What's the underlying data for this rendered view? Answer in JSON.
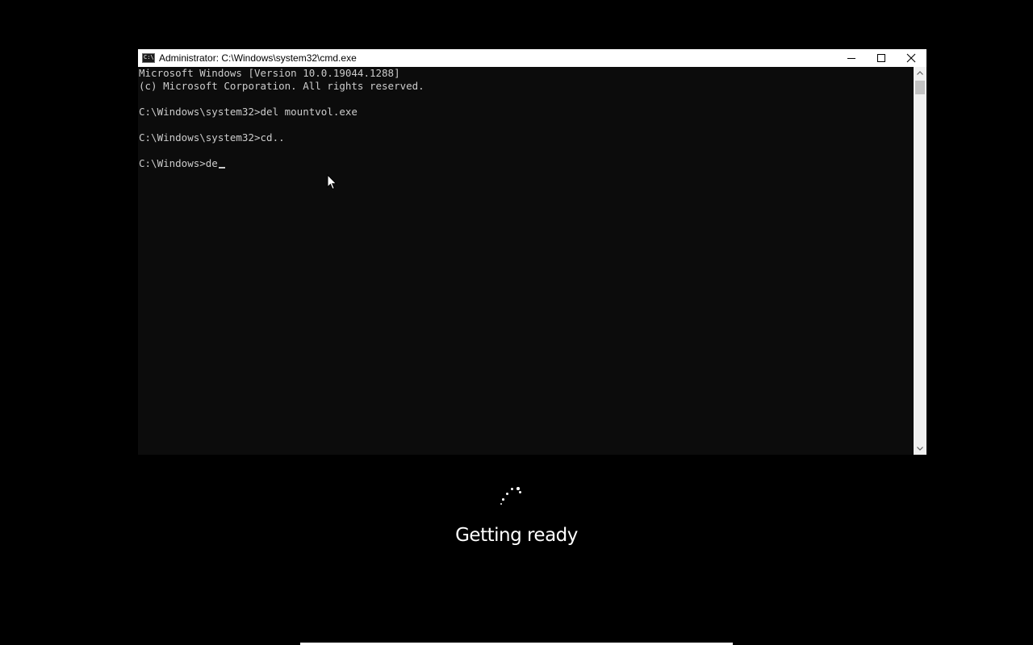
{
  "window": {
    "title": "Administrator: C:\\Windows\\system32\\cmd.exe",
    "icon": "cmd-icon",
    "buttons": {
      "minimize_icon": "minimize-icon",
      "maximize_icon": "maximize-icon",
      "close_icon": "close-icon"
    }
  },
  "console": {
    "lines": [
      "Microsoft Windows [Version 10.0.19044.1288]",
      "(c) Microsoft Corporation. All rights reserved.",
      "",
      "C:\\Windows\\system32>del mountvol.exe",
      "",
      "C:\\Windows\\system32>cd..",
      "",
      "C:\\Windows>de"
    ],
    "text_color": "#cccccc",
    "background": "#0c0c0c"
  },
  "setup": {
    "status": "Getting ready",
    "spinner_icon": "loading-spinner-icon"
  },
  "colors": {
    "screen_background": "#000000",
    "titlebar": "#ffffff"
  }
}
